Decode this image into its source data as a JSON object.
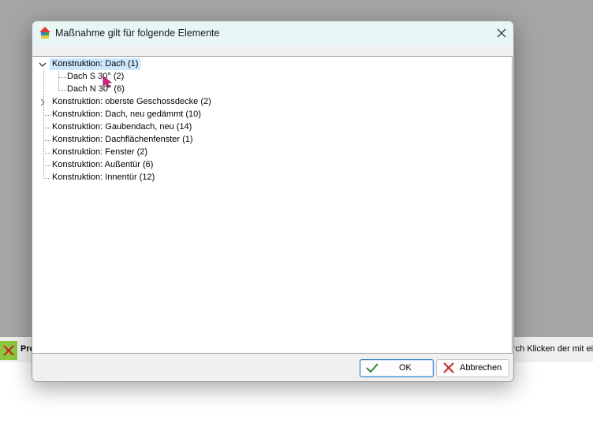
{
  "background": {
    "status_left_text": "Pro",
    "status_right_text": "rch Klicken der mit ei"
  },
  "dialog": {
    "title": "Maßnahme gilt für folgende Elemente",
    "tree": [
      {
        "label": "Konstruktion: Dach (1)",
        "expanded": true,
        "selected": true,
        "children": [
          {
            "label": "Dach S 30° (2)"
          },
          {
            "label": "Dach N 30° (6)"
          }
        ]
      },
      {
        "label": "Konstruktion: oberste Geschossdecke (2)",
        "expandable": true
      },
      {
        "label": "Konstruktion: Dach, neu gedämmt (10)"
      },
      {
        "label": "Konstruktion: Gaubendach, neu (14)"
      },
      {
        "label": "Konstruktion: Dachflächenfenster (1)"
      },
      {
        "label": "Konstruktion: Fenster (2)"
      },
      {
        "label": "Konstruktion: Außentür (6)"
      },
      {
        "label": "Konstruktion: Innentür (12)"
      }
    ],
    "buttons": {
      "ok_label": "OK",
      "cancel_label": "Abbrechen"
    }
  },
  "colors": {
    "titlebar": "#e7f5f5",
    "selection": "#cce8ff",
    "ok_check": "#2e8b2e",
    "cancel_x": "#c62828",
    "error_icon_bg": "#8cc63f"
  },
  "icons": {
    "title_icon": "house-icon",
    "close": "close-icon",
    "ok": "checkmark-icon",
    "cancel": "cross-icon",
    "status": "error-x-icon"
  }
}
